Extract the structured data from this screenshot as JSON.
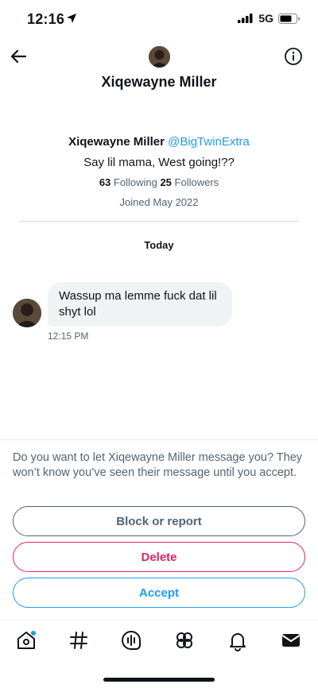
{
  "status_bar": {
    "time": "12:16",
    "network": "5G"
  },
  "header": {
    "title": "Xiqewayne Miller"
  },
  "profile": {
    "name": "Xiqewayne Miller",
    "handle": "@BigTwinExtra",
    "bio": "Say lil mama, West going!??",
    "following_count": "63",
    "following_label": "Following",
    "followers_count": "25",
    "followers_label": "Followers",
    "joined": "Joined May 2022"
  },
  "conversation": {
    "date_label": "Today",
    "messages": [
      {
        "text": "Wassup ma lemme fuck dat lil shyt lol",
        "time": "12:15 PM"
      }
    ]
  },
  "request": {
    "prompt": "Do you want to let Xiqewayne Miller message you? They won’t know you’ve seen their message until you accept.",
    "block_label": "Block or report",
    "delete_label": "Delete",
    "accept_label": "Accept"
  },
  "tabs": [
    {
      "icon": "home-icon"
    },
    {
      "icon": "explore-hashtag-icon"
    },
    {
      "icon": "spaces-icon"
    },
    {
      "icon": "communities-icon"
    },
    {
      "icon": "notifications-bell-icon"
    },
    {
      "icon": "messages-envelope-icon"
    }
  ],
  "colors": {
    "accent": "#1d9bf0",
    "danger": "#e0245e",
    "muted": "#536471",
    "text": "#0f1419"
  }
}
